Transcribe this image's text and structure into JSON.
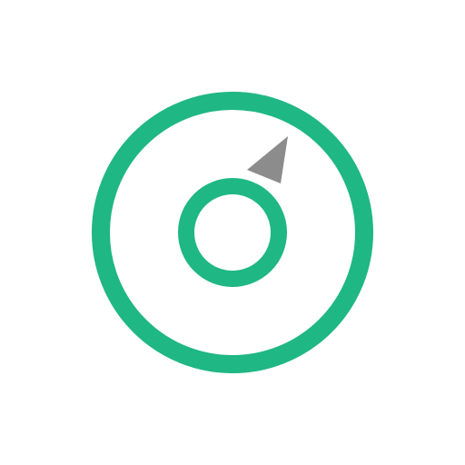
{
  "icon": {
    "name": "compass-icon",
    "colors": {
      "ring": "#1fb784",
      "needle": "#8c8c8c",
      "background": "#ffffff"
    }
  }
}
